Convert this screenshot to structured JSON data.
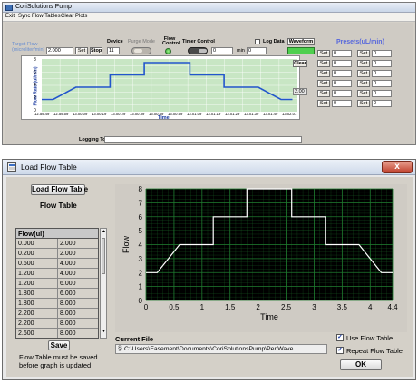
{
  "top_window": {
    "title": "CoriSolutions Pump",
    "menu": [
      "Exit",
      "Sync Flow Tables",
      "Clear Plots"
    ],
    "target_flow_label": "Target Flow (microliter/min)",
    "target_flow_value": "2.000",
    "set_label": "Set",
    "stop_label": "Stop",
    "device_label": "Device",
    "device_value": "11",
    "purge_mode_label": "Purge Mode",
    "flow_control_label": "Flow Control",
    "timer_control_label": "Timer Control",
    "timer_value": "0",
    "min_label": "min",
    "timer_value_2": "0",
    "log_data_label": "Log Data",
    "waveform_label": "Waveform",
    "clear_label": "Clear",
    "plot_value_right": "2.00",
    "presets_title": "Presets(uL/min)",
    "preset_rows": [
      {
        "set": "Set",
        "value": "0"
      },
      {
        "set": "Set",
        "value": "0"
      },
      {
        "set": "Set",
        "value": "0"
      },
      {
        "set": "Set",
        "value": "0"
      },
      {
        "set": "Set",
        "value": "0"
      },
      {
        "set": "Set",
        "value": "0"
      }
    ],
    "logging_to_label": "Logging To:",
    "plot": {
      "ylabel": "Flow Rate (ul/min)",
      "xlabel": "Time",
      "y_ticks": [
        "8",
        "6",
        "4",
        "2",
        "0"
      ],
      "x_ticks": [
        "12:59:49",
        "12:59:59",
        "13:00:09",
        "13:00:19",
        "13:00:29",
        "13:00:39",
        "13:00:49",
        "13:00:59",
        "13:01:09",
        "13:01:19",
        "13:01:29",
        "13:01:39",
        "13:01:49",
        "13:02:01"
      ],
      "color_line": "#2255cc",
      "color_bg": "#c8e6c4"
    }
  },
  "dialog": {
    "title": "Load Flow Table",
    "load_button": "Load Flow Table",
    "flow_table_title": "Flow Table",
    "table_header": "Flow(ul)",
    "table_rows": [
      [
        "0.000",
        "2.000"
      ],
      [
        "0.200",
        "2.000"
      ],
      [
        "0.600",
        "4.000"
      ],
      [
        "1.200",
        "4.000"
      ],
      [
        "1.200",
        "6.000"
      ],
      [
        "1.800",
        "6.000"
      ],
      [
        "1.800",
        "8.000"
      ],
      [
        "2.200",
        "8.000"
      ],
      [
        "2.200",
        "8.000"
      ],
      [
        "2.600",
        "8.000"
      ]
    ],
    "save_button": "Save",
    "save_note_1": "Flow Table must be saved",
    "save_note_2": "before graph is updated",
    "current_file_label": "Current File",
    "current_file_path": "C:\\Users\\Easement\\Documents\\CoriSolutionsPump\\PeriWave",
    "use_flow_table_label": "Use Flow Table",
    "repeat_flow_table_label": "Repeat Flow Table",
    "ok_button": "OK",
    "close_glyph": "x"
  },
  "chart_data": {
    "type": "line",
    "title": "",
    "xlabel": "Time",
    "ylabel": "Flow",
    "xlim": [
      0,
      4.4
    ],
    "ylim": [
      0,
      8
    ],
    "x_ticks": [
      "0",
      "0.5",
      "1",
      "1.5",
      "2",
      "2.5",
      "3",
      "3.5",
      "4",
      "4.4"
    ],
    "y_ticks": [
      "0",
      "1",
      "2",
      "3",
      "4",
      "5",
      "6",
      "7",
      "8"
    ],
    "grid": true,
    "series": [
      {
        "x": [
          0,
          0.2,
          0.6,
          1.2,
          1.2,
          1.8,
          1.8,
          2.6,
          2.6,
          3.2,
          3.2,
          3.8,
          4.2,
          4.4
        ],
        "y": [
          2,
          2,
          4,
          4,
          6,
          6,
          8,
          8,
          6,
          6,
          4,
          4,
          2,
          2
        ]
      }
    ],
    "colors": {
      "background": "#000000",
      "grid": "#1f7a2f",
      "line": "#ffffff"
    }
  }
}
